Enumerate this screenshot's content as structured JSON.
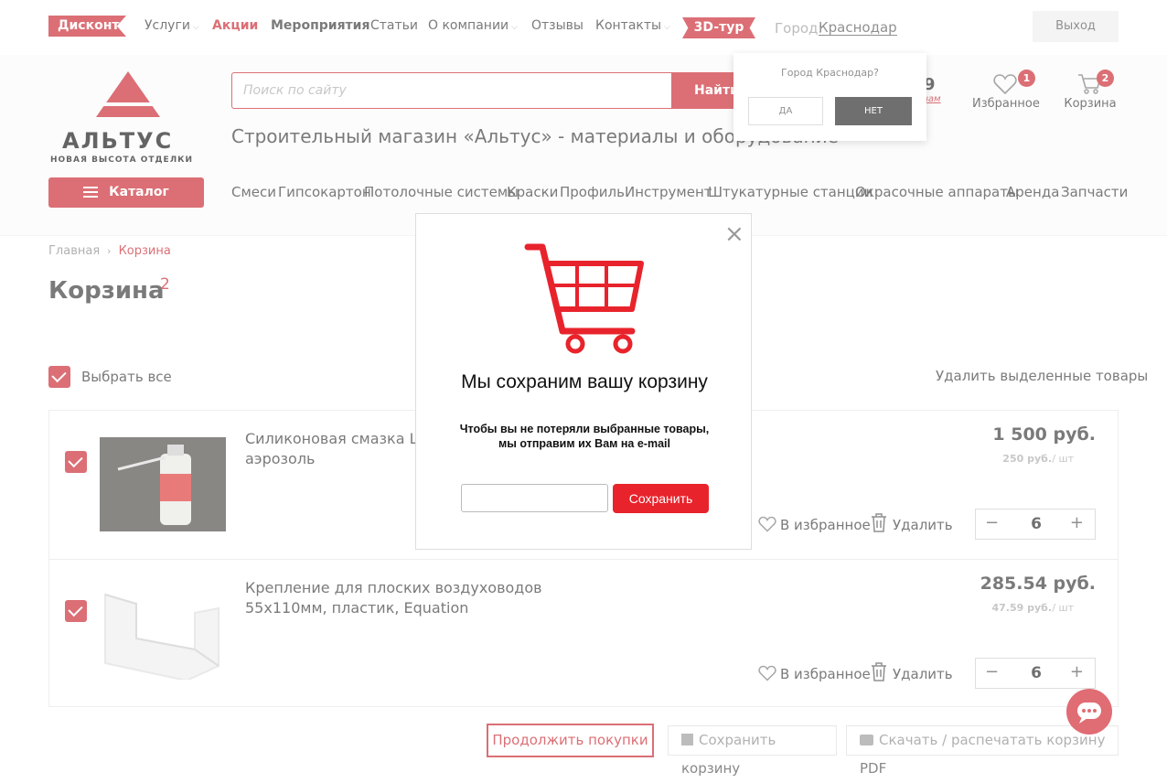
{
  "topnav": {
    "discount_label": "Дисконт",
    "items": [
      {
        "label": "Услуги",
        "has_dropdown": true,
        "style": "normal"
      },
      {
        "label": "Акции",
        "has_dropdown": false,
        "style": "red"
      },
      {
        "label": "Мероприятия",
        "has_dropdown": false,
        "style": "bold"
      },
      {
        "label": "Статьи",
        "has_dropdown": false,
        "style": "normal"
      },
      {
        "label": "О компании",
        "has_dropdown": true,
        "style": "normal"
      },
      {
        "label": "Отзывы",
        "has_dropdown": false,
        "style": "normal"
      },
      {
        "label": "Контакты",
        "has_dropdown": true,
        "style": "normal"
      }
    ],
    "tour_label": "3D-тур",
    "city_label": "Город:",
    "city_value": "Краснодар",
    "logout_label": "Выход"
  },
  "header": {
    "logo_text": "АЛЬТУС",
    "logo_subtitle": "НОВАЯ ВЫСОТА ОТДЕЛКИ",
    "catalog_label": "Каталог",
    "search_placeholder": "Поиск по сайту",
    "search_button": "Найти",
    "phone_fragment": "9",
    "phone_sub_fragment": "чам",
    "favorites_label": "Избранное",
    "favorites_count": "1",
    "cart_label": "Корзина",
    "cart_count": "2",
    "tagline": "Строительный магазин «Альтус» - материалы и оборудование",
    "categories": [
      "Смеси",
      "Гипсокартон",
      "Потолочные системы",
      "Краски",
      "Профиль",
      "Инструмент",
      "Штукатурные станции",
      "Окрасочные аппараты",
      "Аренда",
      "Запчасти"
    ]
  },
  "city_popup": {
    "question": "Город Краснодар?",
    "yes_label": "ДА",
    "no_label": "НЕТ"
  },
  "breadcrumb": {
    "home": "Главная",
    "separator": "›",
    "current": "Корзина"
  },
  "cart": {
    "title": "Корзина",
    "count": "2",
    "select_all_label": "Выбрать все",
    "delete_selected_label": "Удалить выделенные товары",
    "items": [
      {
        "name": "Силиконовая смазка Leo шнековых пар, аэрозоль",
        "price": "1 500 руб.",
        "unit_price": "250 руб.",
        "unit": "/ шт",
        "favorite_label": "В избранное",
        "delete_label": "Удалить",
        "quantity": "6",
        "checked": true
      },
      {
        "name": "Крепление для плоских воздуховодов 55х110мм, пластик, Equation",
        "price": "285.54 руб.",
        "unit_price": "47.59 руб.",
        "unit": "/ шт",
        "favorite_label": "В избранное",
        "delete_label": "Удалить",
        "quantity": "6",
        "checked": true
      }
    ],
    "continue_label": "Продолжить покупки",
    "save_cart_label": "Сохранить корзину",
    "download_label": "Скачать / распечатать корзину PDF"
  },
  "modal": {
    "close_glyph": "×",
    "title": "Мы сохраним вашу корзину",
    "text_line1": "Чтобы вы не потеряли выбранные товары,",
    "text_line2": "мы отправим их Вам на e-mail",
    "email_value": "",
    "save_label": "Сохранить"
  },
  "colors": {
    "brand_red": "#c8232c",
    "modal_red": "#e8232c"
  }
}
